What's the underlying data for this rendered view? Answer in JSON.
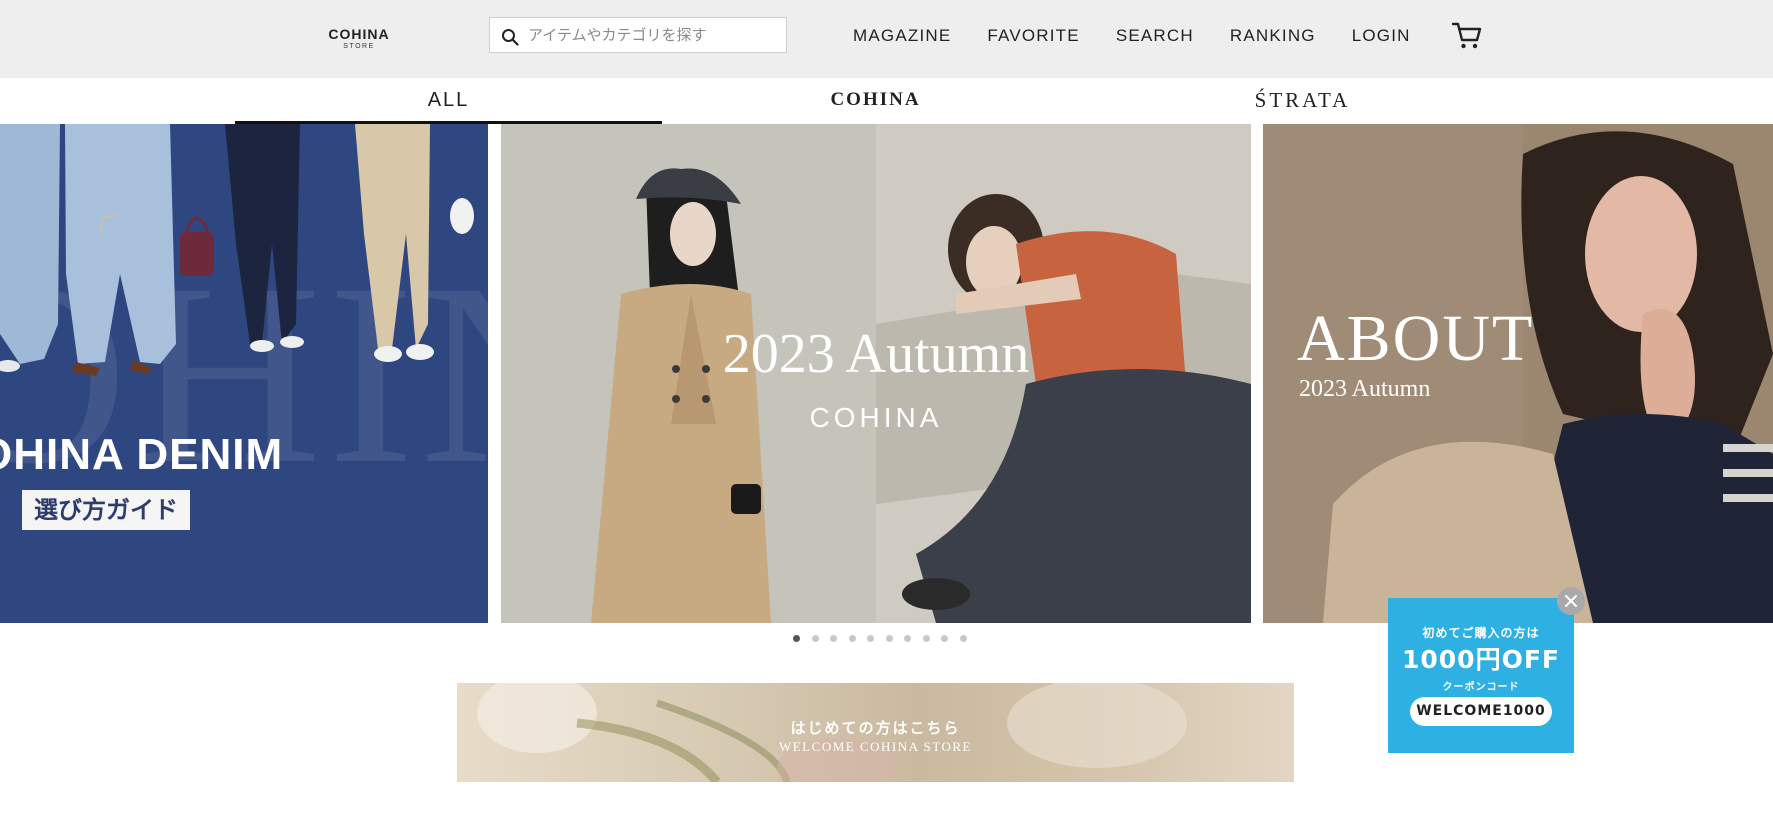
{
  "header": {
    "logo_main": "COHINA",
    "logo_sub": "STORE",
    "search_placeholder": "アイテムやカテゴリを探す",
    "nav": [
      "MAGAZINE",
      "FAVORITE",
      "SEARCH",
      "RANKING",
      "LOGIN"
    ],
    "cart_icon": "cart-icon"
  },
  "tabs": {
    "all": "ALL",
    "cohina": "COHINA",
    "strata": "ŚTRATA",
    "active": "all"
  },
  "hero": {
    "denim": {
      "title": "OHINA DENIM",
      "badge": "選び方ガイド",
      "bg_text": "OHINA DENIM"
    },
    "autumn": {
      "title": "2023 Autumn",
      "brand": "COHINA"
    },
    "about": {
      "title": "ABOUT",
      "subtitle": "2023 Autumn"
    },
    "dots_count": 10,
    "active_dot": 0
  },
  "welcome": {
    "jp": "はじめての方はこちら",
    "en": "WELCOME COHINA STORE"
  },
  "coupon": {
    "line1": "初めてご購入の方は",
    "line2": "1000円OFF",
    "line3": "クーポンコード",
    "code": "WELCOME1000",
    "close_icon": "close-icon"
  },
  "colors": {
    "header_bg": "#eeeeee",
    "denim_bg": "#2f4781",
    "coupon_bg": "#2fb0e3",
    "dot_active": "#555555",
    "dot_inactive": "#c8c8c8"
  }
}
